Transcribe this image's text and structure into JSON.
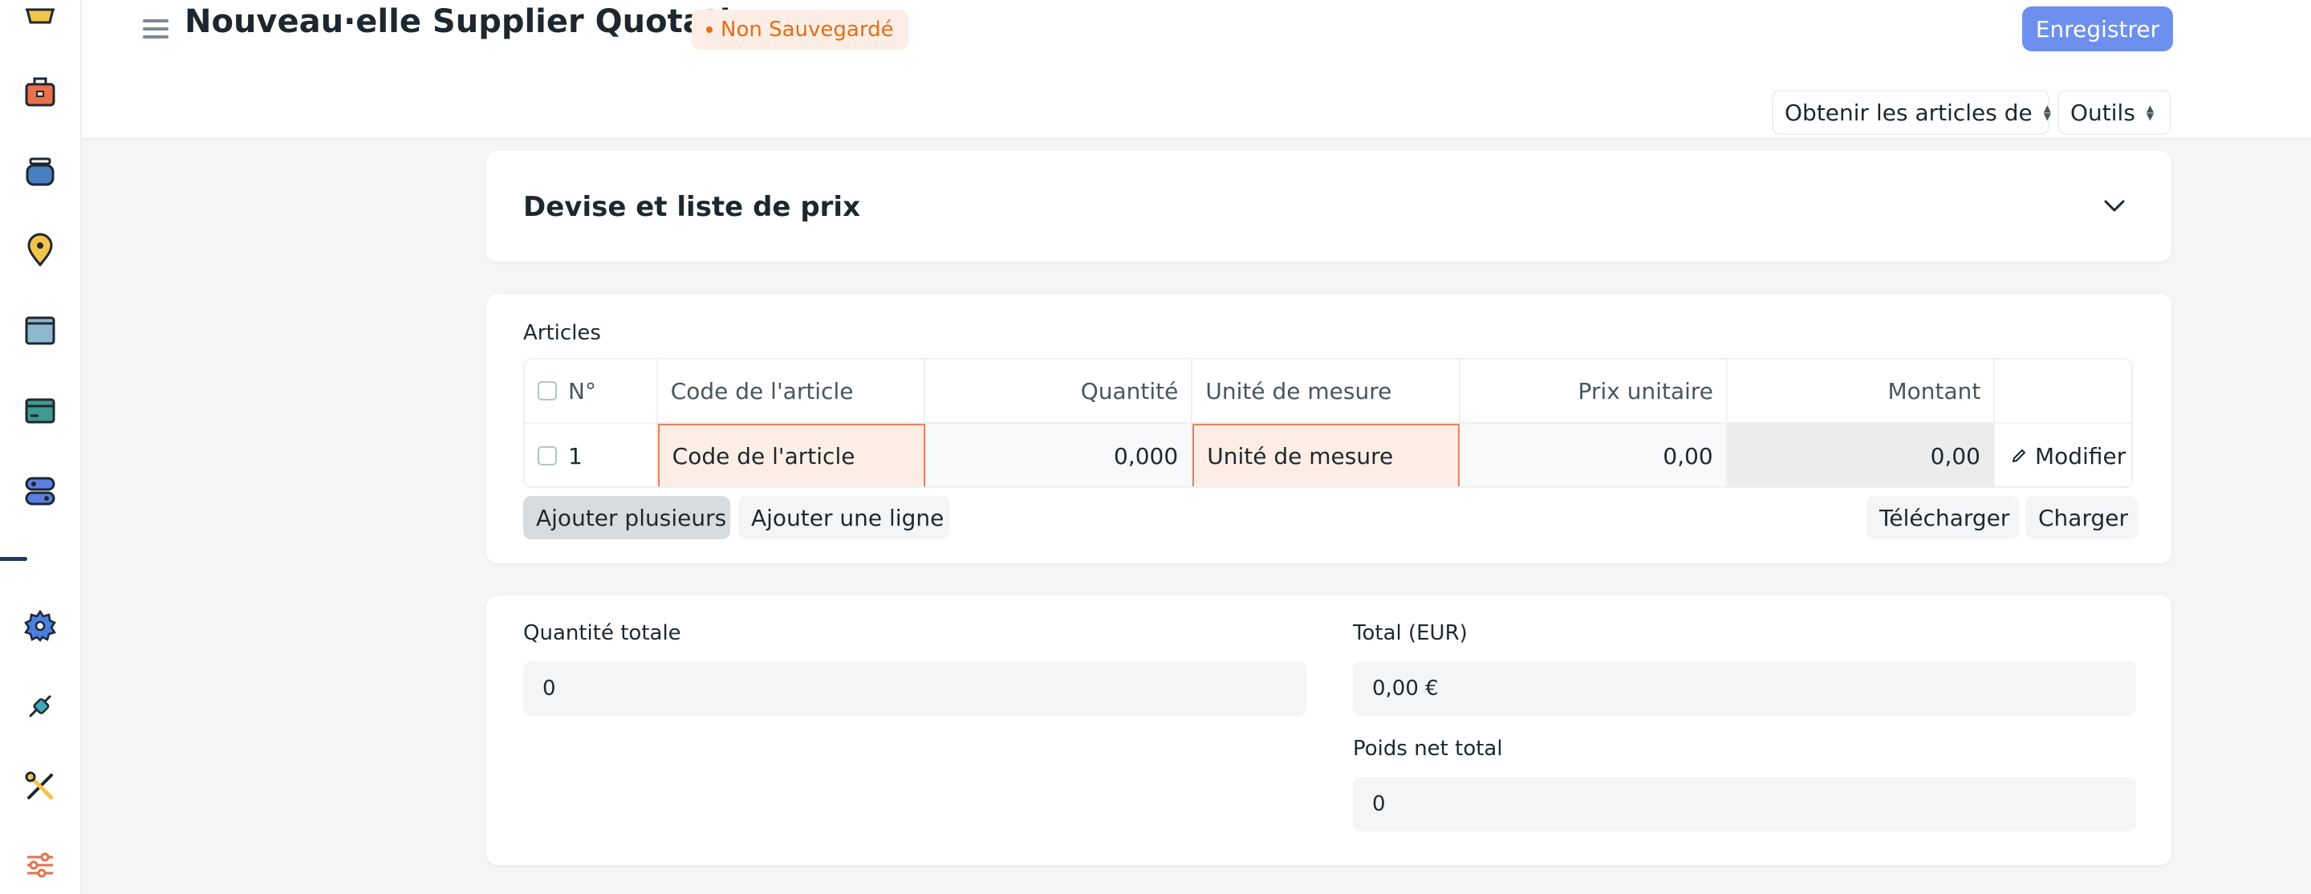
{
  "header": {
    "title": "Nouveau·elle Supplier Quotation",
    "status": "Non Sauvegardé",
    "save_label": "Enregistrer",
    "get_items_label": "Obtenir les articles de",
    "tools_label": "Outils"
  },
  "currency_section": {
    "title": "Devise et liste de prix"
  },
  "items_section": {
    "label": "Articles",
    "columns": [
      "N°",
      "Code de l'article",
      "Quantité",
      "Unité de mesure",
      "Prix unitaire",
      "Montant"
    ],
    "rows": [
      {
        "idx": "1",
        "item_code_placeholder": "Code de l'article",
        "qty": "0,000",
        "uom_placeholder": "Unité de mesure",
        "rate": "0,00",
        "amount": "0,00",
        "edit_label": "Modifier"
      }
    ],
    "add_multiple_label": "Ajouter plusieurs",
    "add_row_label": "Ajouter une ligne",
    "download_label": "Télécharger",
    "upload_label": "Charger"
  },
  "totals": {
    "total_qty_label": "Quantité totale",
    "total_qty": "0",
    "total_label": "Total (EUR)",
    "total": "0,00 €",
    "net_weight_label": "Poids net total",
    "net_weight": "0"
  },
  "sidebar": {
    "icons": [
      "shopping-basket-icon",
      "briefcase-icon",
      "stack-icon",
      "map-pin-icon",
      "window-icon",
      "card-icon",
      "toggle-icon",
      "gear-icon",
      "plug-icon",
      "tools-icon",
      "sliders-icon"
    ]
  },
  "colors": {
    "primary": "#6d90ef",
    "warning_bg": "#fdeee5",
    "warning_text": "#e86c13",
    "invalid_border": "#ee8259"
  }
}
